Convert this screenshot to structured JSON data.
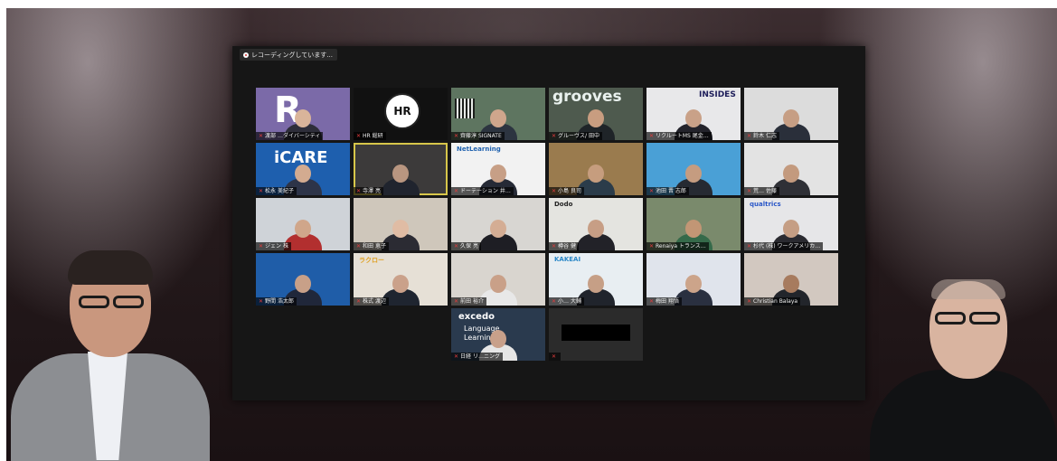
{
  "recording": {
    "label": "レコーディングしています..."
  },
  "participants": [
    {
      "name": "渡部 …ダイバーシティ",
      "bg": "#7b6aa8",
      "brand": "R",
      "brand_color": "#ffffff",
      "skin": "#d9b49a",
      "shirt": "#2e2e3a"
    },
    {
      "name": "HR 総研",
      "bg": "#111111",
      "logo": "HR",
      "skin": "",
      "shirt": ""
    },
    {
      "name": "齊藤淳 SIGNATE",
      "bg": "#5e7560",
      "skin": "#cfa68c",
      "shirt": "#2c3440",
      "qr": true
    },
    {
      "name": "グルーヴス/ 田中",
      "bg": "#4e5a4e",
      "brand": "grooves",
      "brand_color": "#e9f1ee",
      "skin": "#c89d80",
      "shirt": "#1f2428"
    },
    {
      "name": "リクルートMS 尾金…",
      "bg": "#e8e8ea",
      "brand": "INSIDES",
      "brand_color": "#1d1d5a",
      "skin": "#c9a188",
      "shirt": "#23232b"
    },
    {
      "name": "鈴木 仁志",
      "bg": "#dcdcdc",
      "skin": "#c69e84",
      "shirt": "#2a2f3a"
    },
    {
      "name": "松永 美紀子",
      "bg": "#1e5fae",
      "brand": "iCARE",
      "brand_color": "#ffffff",
      "skin": "#d3ab90",
      "shirt": "#2d3448"
    },
    {
      "name": "寺澤 亮",
      "bg": "#3c3a3a",
      "skin": "#b99680",
      "shirt": "#20242e"
    },
    {
      "name": "ドーテーション 井…",
      "bg": "#f2f2f2",
      "brand": "NetLearning",
      "brand_color": "#2364b0",
      "skin": "#c79f86",
      "shirt": "#262a36"
    },
    {
      "name": "小島 良司",
      "bg": "#9a7b4e",
      "skin": "#c69d7e",
      "shirt": "#2b3c4a"
    },
    {
      "name": "池田 晋 志郎",
      "bg": "#4aa0d6",
      "skin": "#c59c80",
      "shirt": "#262a32"
    },
    {
      "name": "荒… 佐藤",
      "bg": "#e3e3e3",
      "skin": "#c39a7e",
      "shirt": "#2f3036"
    },
    {
      "name": "ジェン 株",
      "bg": "#cfd3d8",
      "skin": "#d0a68a",
      "shirt": "#b22f2f"
    },
    {
      "name": "和田 恵子",
      "bg": "#cfc7bb",
      "skin": "#e0bca4",
      "shirt": "#2b2b33"
    },
    {
      "name": "久保 亮",
      "bg": "#d8d6d2",
      "skin": "#d4ad94",
      "shirt": "#1e1e24"
    },
    {
      "name": "樽谷 健",
      "bg": "#e4e4e0",
      "brand": "Dodo",
      "brand_color": "#222222",
      "skin": "#c79e85",
      "shirt": "#222228"
    },
    {
      "name": "Renaiya トランス…",
      "bg": "#7a8a6c",
      "skin": "#c29675",
      "shirt": "#356a4a"
    },
    {
      "name": "杉代 (株) ワークアメリカ…",
      "bg": "#e6e6e8",
      "brand": "qualtrics",
      "brand_color": "#2a57c8",
      "skin": "#c59e84",
      "shirt": "#2a2a30"
    },
    {
      "name": "野間 浩太郎",
      "bg": "#1f5da8",
      "skin": "#c8a088",
      "shirt": "#20273a"
    },
    {
      "name": "株式 渡辺",
      "bg": "#e6e0d6",
      "brand": "ラクロー",
      "brand_color": "#e0a020",
      "skin": "#caa18a",
      "shirt": "#1f2530"
    },
    {
      "name": "前田 裕介",
      "bg": "#d9d5cf",
      "skin": "#c9a088",
      "shirt": "#e8e8e8"
    },
    {
      "name": "小… 大輔",
      "bg": "#e8eef2",
      "brand": "KAKEAI",
      "brand_color": "#2b88c8",
      "skin": "#c69f86",
      "shirt": "#20242c"
    },
    {
      "name": "梅田 翔悟",
      "bg": "#e0e4ec",
      "skin": "#cca48a",
      "shirt": "#2a3040"
    },
    {
      "name": "Christian Balaya",
      "bg": "#d2c8c0",
      "skin": "#a77b5e",
      "shirt": "#22252b"
    },
    {
      "name": "日経 リ…ニング",
      "bg": "#2a3a4e",
      "brand": "excedo",
      "brand_color": "#ffffff",
      "sub": "Language Learning",
      "skin": "#c8a08a",
      "shirt": "#e6e6e6"
    },
    {
      "name": "",
      "bg": "#2b2b2b",
      "blank": true,
      "skin": "",
      "shirt": ""
    }
  ],
  "presenters": [
    {
      "skin": "#c9977e",
      "hair": "#2a2220",
      "jacket": "#8c8e92",
      "shirt": "#eef0f4"
    },
    {
      "skin": "#d9b4a0",
      "hair": "#b9a9a0",
      "jacket": "#111214",
      "shirt": "#111214"
    }
  ]
}
